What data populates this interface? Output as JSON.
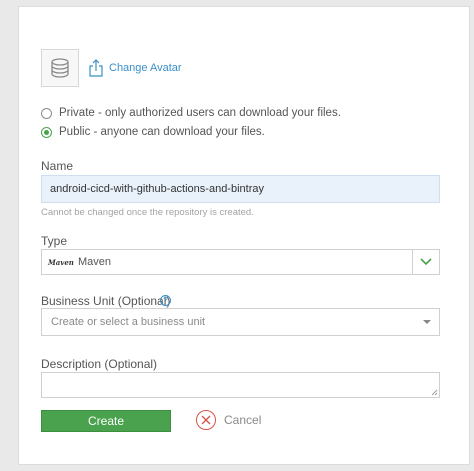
{
  "avatar": {
    "icon": "database-icon",
    "change_label": "Change Avatar"
  },
  "visibility": {
    "private_label": "Private - only authorized users can download your files.",
    "public_label": "Public - anyone can download your files.",
    "selected": "public"
  },
  "name": {
    "label": "Name",
    "value": "android-cicd-with-github-actions-and-bintray",
    "hint": "Cannot be changed once the repository is created."
  },
  "type": {
    "label": "Type",
    "logo_text": "Maven",
    "value": "Maven"
  },
  "business_unit": {
    "label": "Business Unit (Optional)",
    "placeholder": "Create or select a business unit"
  },
  "description": {
    "label": "Description (Optional)",
    "value": ""
  },
  "actions": {
    "create_label": "Create",
    "cancel_label": "Cancel"
  },
  "colors": {
    "accent_green": "#4aa24e",
    "link_blue": "#3a8fc9",
    "cancel_red": "#d9534f"
  }
}
